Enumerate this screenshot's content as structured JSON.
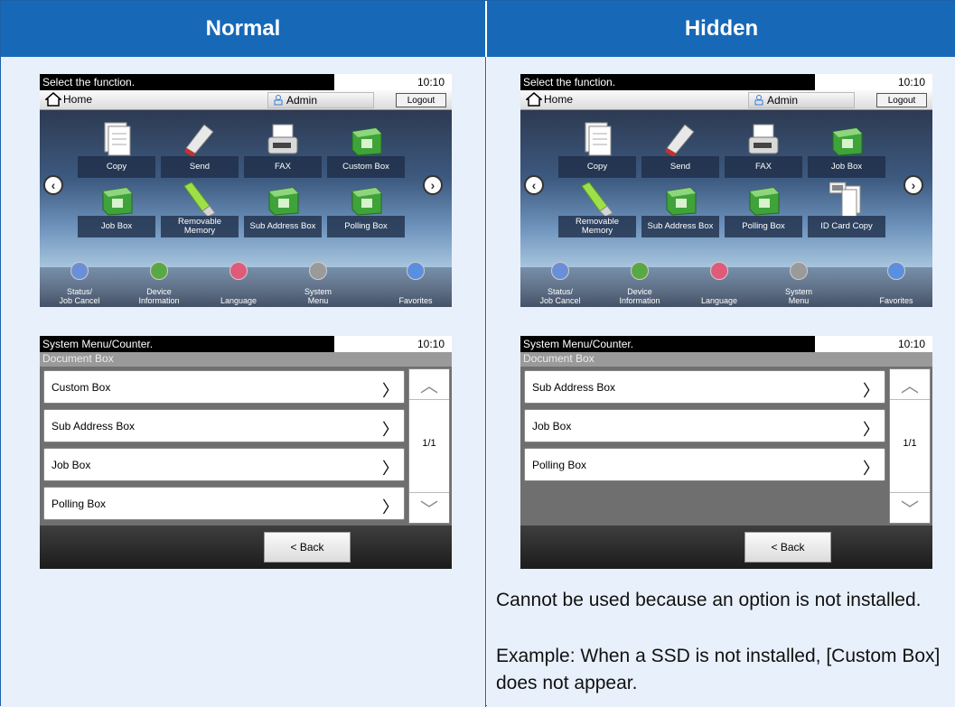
{
  "headers": {
    "normal": "Normal",
    "hidden": "Hidden"
  },
  "home_screen": {
    "prompt": "Select the function.",
    "time": "10:10",
    "home_label": "Home",
    "user": "Admin",
    "logout": "Logout",
    "dock": [
      "Status/\nJob Cancel",
      "Device\nInformation",
      "Language",
      "System\nMenu",
      "Favorites"
    ]
  },
  "normal_tiles": [
    "Copy",
    "Send",
    "FAX",
    "Custom Box",
    "Job Box",
    "Removable\nMemory",
    "Sub Address Box",
    "Polling Box"
  ],
  "hidden_tiles": [
    "Copy",
    "Send",
    "FAX",
    "Job Box",
    "Removable\nMemory",
    "Sub Address Box",
    "Polling Box",
    "ID Card Copy"
  ],
  "doc_screen": {
    "prompt": "System Menu/Counter.",
    "time": "10:10",
    "subtitle": "Document Box",
    "page": "1/1",
    "back": "< Back"
  },
  "normal_list": [
    "Custom Box",
    "Sub Address Box",
    "Job Box",
    "Polling Box"
  ],
  "hidden_list": [
    "Sub Address Box",
    "Job Box",
    "Polling Box"
  ],
  "note": {
    "p1": "Cannot be used because an option is not installed.",
    "p2": "Example: When a SSD is not installed, [Custom Box] does not appear."
  }
}
